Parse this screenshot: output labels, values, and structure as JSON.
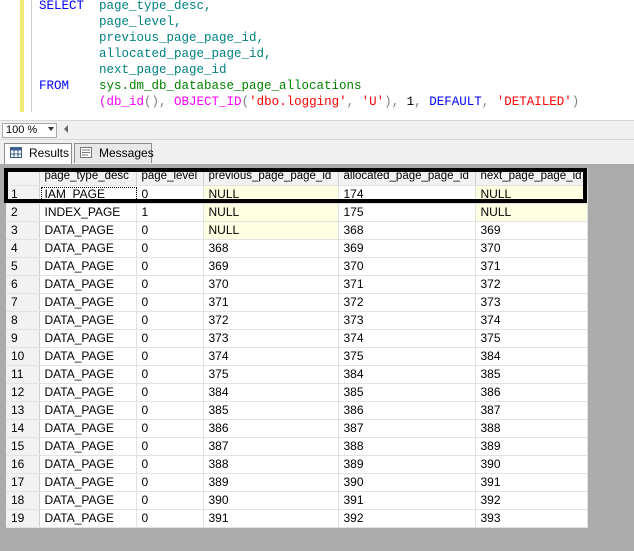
{
  "editor": {
    "lines": [
      [
        {
          "t": "SELECT",
          "c": "kw"
        },
        {
          "t": "  page_type_desc,",
          "c": "id"
        }
      ],
      [
        {
          "t": "        page_level,",
          "c": "id"
        }
      ],
      [
        {
          "t": "        previous_page_page_id,",
          "c": "id"
        }
      ],
      [
        {
          "t": "        allocated_page_page_id,",
          "c": "id"
        }
      ],
      [
        {
          "t": "        next_page_page_id",
          "c": "id"
        }
      ],
      [
        {
          "t": "FROM",
          "c": "kw"
        },
        {
          "t": "    sys.dm_db_database_page_allocations",
          "c": "sys"
        }
      ],
      [
        {
          "t": "        (db_id",
          "c": "fn"
        },
        {
          "t": "(), ",
          "c": "gray"
        },
        {
          "t": "OBJECT_ID",
          "c": "fn"
        },
        {
          "t": "(",
          "c": "gray"
        },
        {
          "t": "'dbo.logging'",
          "c": "str"
        },
        {
          "t": ", ",
          "c": "gray"
        },
        {
          "t": "'U'",
          "c": "str"
        },
        {
          "t": "), ",
          "c": "gray"
        },
        {
          "t": "1",
          "c": "plain"
        },
        {
          "t": ", ",
          "c": "gray"
        },
        {
          "t": "DEFAULT",
          "c": "kw"
        },
        {
          "t": ", ",
          "c": "gray"
        },
        {
          "t": "'DETAILED'",
          "c": "str"
        },
        {
          "t": ")",
          "c": "gray"
        }
      ]
    ]
  },
  "zoom": {
    "value": "100 %"
  },
  "tabs": {
    "results": "Results",
    "messages": "Messages"
  },
  "grid": {
    "columns": [
      "page_type_desc",
      "page_level",
      "previous_page_page_id",
      "allocated_page_page_id",
      "next_page_page_id"
    ],
    "rows": [
      [
        "1",
        "IAM_PAGE",
        "0",
        "NULL",
        "174",
        "NULL"
      ],
      [
        "2",
        "INDEX_PAGE",
        "1",
        "NULL",
        "175",
        "NULL"
      ],
      [
        "3",
        "DATA_PAGE",
        "0",
        "NULL",
        "368",
        "369"
      ],
      [
        "4",
        "DATA_PAGE",
        "0",
        "368",
        "369",
        "370"
      ],
      [
        "5",
        "DATA_PAGE",
        "0",
        "369",
        "370",
        "371"
      ],
      [
        "6",
        "DATA_PAGE",
        "0",
        "370",
        "371",
        "372"
      ],
      [
        "7",
        "DATA_PAGE",
        "0",
        "371",
        "372",
        "373"
      ],
      [
        "8",
        "DATA_PAGE",
        "0",
        "372",
        "373",
        "374"
      ],
      [
        "9",
        "DATA_PAGE",
        "0",
        "373",
        "374",
        "375"
      ],
      [
        "10",
        "DATA_PAGE",
        "0",
        "374",
        "375",
        "384"
      ],
      [
        "11",
        "DATA_PAGE",
        "0",
        "375",
        "384",
        "385"
      ],
      [
        "12",
        "DATA_PAGE",
        "0",
        "384",
        "385",
        "386"
      ],
      [
        "13",
        "DATA_PAGE",
        "0",
        "385",
        "386",
        "387"
      ],
      [
        "14",
        "DATA_PAGE",
        "0",
        "386",
        "387",
        "388"
      ],
      [
        "15",
        "DATA_PAGE",
        "0",
        "387",
        "388",
        "389"
      ],
      [
        "16",
        "DATA_PAGE",
        "0",
        "388",
        "389",
        "390"
      ],
      [
        "17",
        "DATA_PAGE",
        "0",
        "389",
        "390",
        "391"
      ],
      [
        "18",
        "DATA_PAGE",
        "0",
        "390",
        "391",
        "392"
      ],
      [
        "19",
        "DATA_PAGE",
        "0",
        "391",
        "392",
        "393"
      ]
    ]
  }
}
